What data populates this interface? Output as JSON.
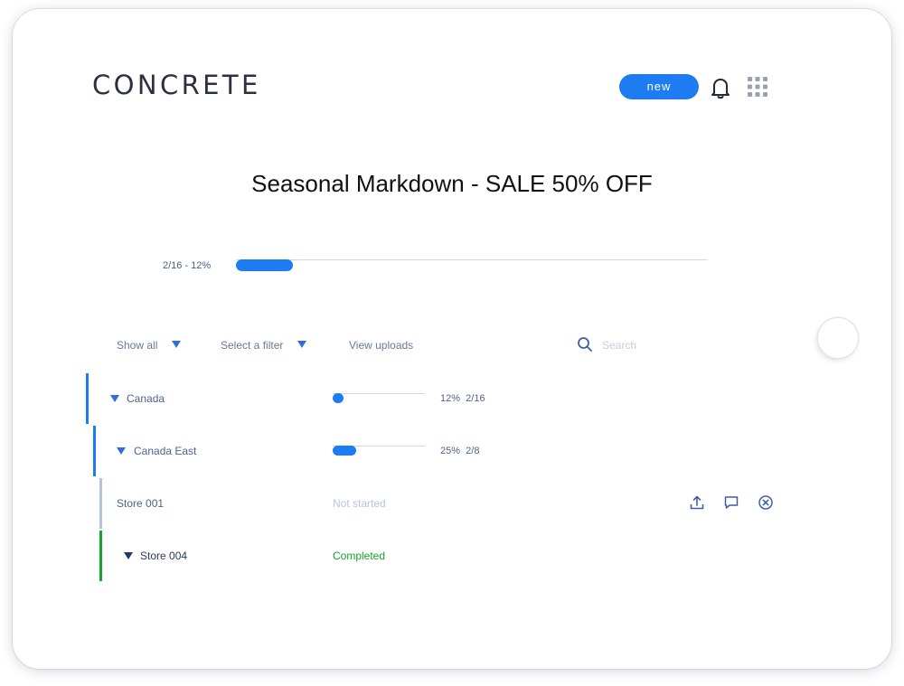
{
  "header": {
    "logo": "CONCRETE",
    "new_label": "new",
    "icons": {
      "notifications": "bell-icon",
      "apps": "apps-grid-icon"
    }
  },
  "campaign": {
    "title": "Seasonal Markdown - SALE 50% OFF",
    "progress_label": "2/16 - 12%",
    "progress_fraction": 0.12
  },
  "toolbar": {
    "show_all": "Show all",
    "select_filter": "Select a filter",
    "view_uploads": "View uploads",
    "search_placeholder": "Search"
  },
  "rows": {
    "canada": {
      "name": "Canada",
      "progress_fraction": 0.12,
      "pct": "12%",
      "count": "2/16"
    },
    "canada_east": {
      "name": "Canada East",
      "progress_fraction": 0.25,
      "pct": "25%",
      "count": "2/8"
    },
    "store_001": {
      "name": "Store 001",
      "status": "Not started"
    },
    "store_004": {
      "name": "Store 004",
      "status": "Completed"
    }
  },
  "colors": {
    "accent": "#1d7cf2",
    "logo": "#2c3142",
    "completed": "#16a52b",
    "not_started": "#b8c4dc",
    "level_bar": "#1d7cf2",
    "pending_bar": "#b6c3e0"
  }
}
